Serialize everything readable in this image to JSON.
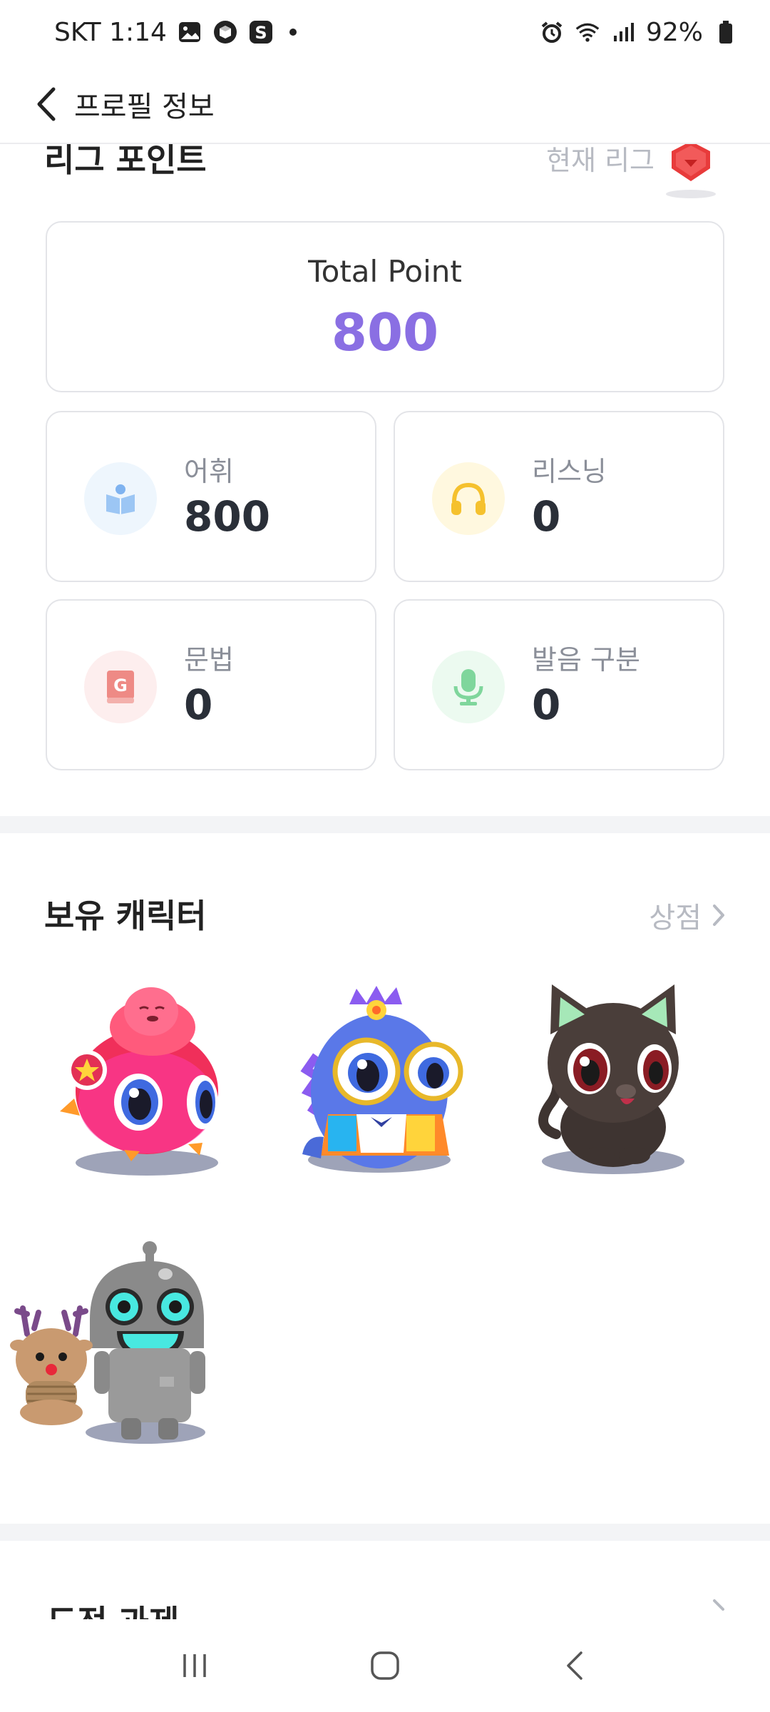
{
  "status_bar": {
    "carrier_time": "SKT 1:14",
    "battery": "92%"
  },
  "header": {
    "title": "프로필 정보"
  },
  "league": {
    "title": "리그 포인트",
    "current_label": "현재 리그"
  },
  "points": {
    "total_label": "Total Point",
    "total_value": "800",
    "stats": [
      {
        "label": "어휘",
        "value": "800",
        "icon": "book-icon",
        "color": "#7fb3f0",
        "bg": "#eef6fd"
      },
      {
        "label": "리스닝",
        "value": "0",
        "icon": "headphones-icon",
        "color": "#f5c12e",
        "bg": "#fff8df"
      },
      {
        "label": "문법",
        "value": "0",
        "icon": "grammar-book-icon",
        "color": "#ee8a85",
        "bg": "#fdeeee"
      },
      {
        "label": "발음 구분",
        "value": "0",
        "icon": "microphone-icon",
        "color": "#7fd69c",
        "bg": "#ecfaf0"
      }
    ]
  },
  "characters": {
    "title": "보유 캐릭터",
    "shop_label": "상점",
    "items": [
      "octopus-fish-character",
      "blue-dino-glasses-character",
      "black-cat-character",
      "robot-reindeer-character"
    ]
  },
  "challenge": {
    "title": "도전 과제"
  },
  "colors": {
    "accent": "#8a6fe3",
    "muted": "#b7bac2",
    "border": "#e3e4e8"
  }
}
